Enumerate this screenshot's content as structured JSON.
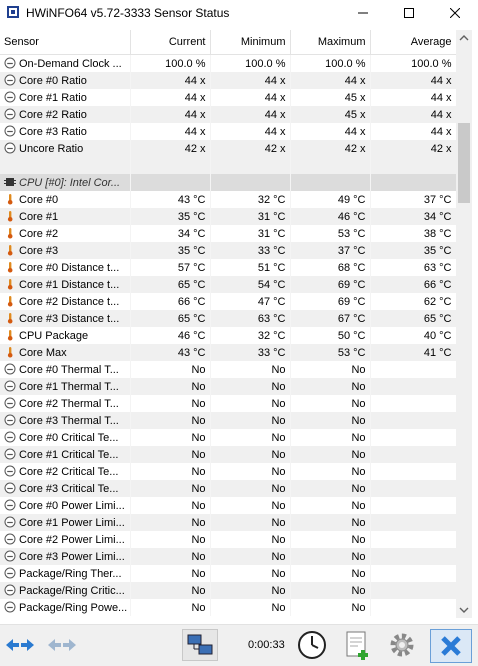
{
  "window": {
    "title": "HWiNFO64 v5.72-3333 Sensor Status"
  },
  "columns": {
    "sensor": "Sensor",
    "current": "Current",
    "minimum": "Minimum",
    "maximum": "Maximum",
    "average": "Average"
  },
  "rows": [
    {
      "kind": "ratio",
      "name": "On-Demand Clock ...",
      "cur": "100.0 %",
      "min": "100.0 %",
      "max": "100.0 %",
      "avg": "100.0 %"
    },
    {
      "kind": "ratio",
      "name": "Core #0 Ratio",
      "cur": "44 x",
      "min": "44 x",
      "max": "44 x",
      "avg": "44 x"
    },
    {
      "kind": "ratio",
      "name": "Core #1 Ratio",
      "cur": "44 x",
      "min": "44 x",
      "max": "45 x",
      "avg": "44 x"
    },
    {
      "kind": "ratio",
      "name": "Core #2 Ratio",
      "cur": "44 x",
      "min": "44 x",
      "max": "45 x",
      "avg": "44 x"
    },
    {
      "kind": "ratio",
      "name": "Core #3 Ratio",
      "cur": "44 x",
      "min": "44 x",
      "max": "44 x",
      "avg": "44 x"
    },
    {
      "kind": "ratio",
      "name": "Uncore Ratio",
      "cur": "42 x",
      "min": "42 x",
      "max": "42 x",
      "avg": "42 x"
    },
    {
      "kind": "blank",
      "name": "",
      "cur": "",
      "min": "",
      "max": "",
      "avg": ""
    },
    {
      "kind": "group",
      "name": "CPU [#0]: Intel Cor...",
      "cur": "",
      "min": "",
      "max": "",
      "avg": ""
    },
    {
      "kind": "temp",
      "name": "Core #0",
      "cur": "43 °C",
      "min": "32 °C",
      "max": "49 °C",
      "avg": "37 °C"
    },
    {
      "kind": "temp",
      "name": "Core #1",
      "cur": "35 °C",
      "min": "31 °C",
      "max": "46 °C",
      "avg": "34 °C"
    },
    {
      "kind": "temp",
      "name": "Core #2",
      "cur": "34 °C",
      "min": "31 °C",
      "max": "53 °C",
      "avg": "38 °C"
    },
    {
      "kind": "temp",
      "name": "Core #3",
      "cur": "35 °C",
      "min": "33 °C",
      "max": "37 °C",
      "avg": "35 °C"
    },
    {
      "kind": "temp",
      "name": "Core #0 Distance t...",
      "cur": "57 °C",
      "min": "51 °C",
      "max": "68 °C",
      "avg": "63 °C"
    },
    {
      "kind": "temp",
      "name": "Core #1 Distance t...",
      "cur": "65 °C",
      "min": "54 °C",
      "max": "69 °C",
      "avg": "66 °C"
    },
    {
      "kind": "temp",
      "name": "Core #2 Distance t...",
      "cur": "66 °C",
      "min": "47 °C",
      "max": "69 °C",
      "avg": "62 °C"
    },
    {
      "kind": "temp",
      "name": "Core #3 Distance t...",
      "cur": "65 °C",
      "min": "63 °C",
      "max": "67 °C",
      "avg": "65 °C"
    },
    {
      "kind": "temp",
      "name": "CPU Package",
      "cur": "46 °C",
      "min": "32 °C",
      "max": "50 °C",
      "avg": "40 °C"
    },
    {
      "kind": "temp",
      "name": "Core Max",
      "cur": "43 °C",
      "min": "33 °C",
      "max": "53 °C",
      "avg": "41 °C"
    },
    {
      "kind": "ratio",
      "name": "Core #0 Thermal T...",
      "cur": "No",
      "min": "No",
      "max": "No",
      "avg": ""
    },
    {
      "kind": "ratio",
      "name": "Core #1 Thermal T...",
      "cur": "No",
      "min": "No",
      "max": "No",
      "avg": ""
    },
    {
      "kind": "ratio",
      "name": "Core #2 Thermal T...",
      "cur": "No",
      "min": "No",
      "max": "No",
      "avg": ""
    },
    {
      "kind": "ratio",
      "name": "Core #3 Thermal T...",
      "cur": "No",
      "min": "No",
      "max": "No",
      "avg": ""
    },
    {
      "kind": "ratio",
      "name": "Core #0 Critical Te...",
      "cur": "No",
      "min": "No",
      "max": "No",
      "avg": ""
    },
    {
      "kind": "ratio",
      "name": "Core #1 Critical Te...",
      "cur": "No",
      "min": "No",
      "max": "No",
      "avg": ""
    },
    {
      "kind": "ratio",
      "name": "Core #2 Critical Te...",
      "cur": "No",
      "min": "No",
      "max": "No",
      "avg": ""
    },
    {
      "kind": "ratio",
      "name": "Core #3 Critical Te...",
      "cur": "No",
      "min": "No",
      "max": "No",
      "avg": ""
    },
    {
      "kind": "ratio",
      "name": "Core #0 Power Limi...",
      "cur": "No",
      "min": "No",
      "max": "No",
      "avg": ""
    },
    {
      "kind": "ratio",
      "name": "Core #1 Power Limi...",
      "cur": "No",
      "min": "No",
      "max": "No",
      "avg": ""
    },
    {
      "kind": "ratio",
      "name": "Core #2 Power Limi...",
      "cur": "No",
      "min": "No",
      "max": "No",
      "avg": ""
    },
    {
      "kind": "ratio",
      "name": "Core #3 Power Limi...",
      "cur": "No",
      "min": "No",
      "max": "No",
      "avg": ""
    },
    {
      "kind": "ratio",
      "name": "Package/Ring Ther...",
      "cur": "No",
      "min": "No",
      "max": "No",
      "avg": ""
    },
    {
      "kind": "ratio",
      "name": "Package/Ring Critic...",
      "cur": "No",
      "min": "No",
      "max": "No",
      "avg": ""
    },
    {
      "kind": "ratio",
      "name": "Package/Ring Powe...",
      "cur": "No",
      "min": "No",
      "max": "No",
      "avg": ""
    }
  ],
  "statusbar": {
    "elapsed": "0:00:33"
  },
  "icons": {
    "ratio": "clock-gauge-icon",
    "temp": "thermometer-icon",
    "group": "cpu-chip-icon"
  }
}
